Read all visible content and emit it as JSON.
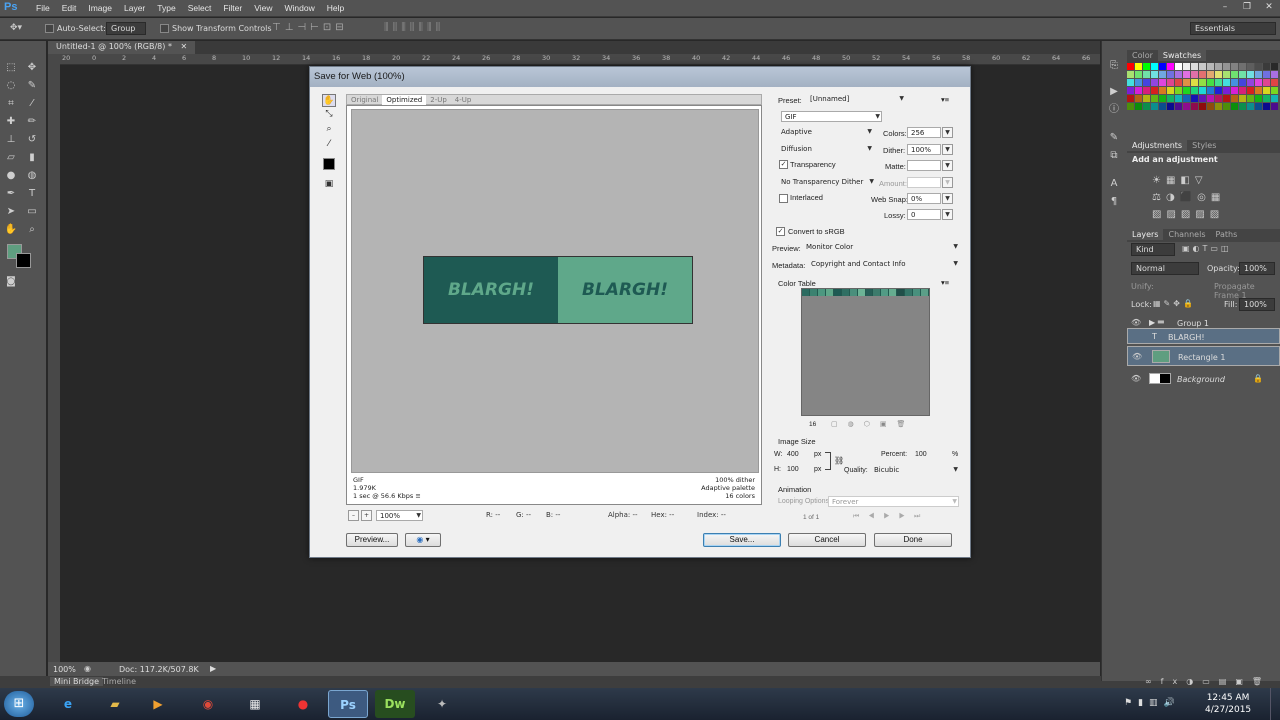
{
  "app": {
    "logo": "Ps",
    "menu": [
      "File",
      "Edit",
      "Image",
      "Layer",
      "Type",
      "Select",
      "Filter",
      "View",
      "Window",
      "Help"
    ],
    "workspace": "Essentials"
  },
  "options_bar": {
    "auto_select_label": "Auto-Select:",
    "auto_select_value": "Group",
    "show_transform_label": "Show Transform Controls"
  },
  "document_tab": "Untitled-1 @ 100% (RGB/8) *",
  "ruler_labels": [
    "20",
    "0",
    "2",
    "4",
    "6",
    "8",
    "10",
    "12",
    "14",
    "16",
    "18",
    "20",
    "22",
    "24",
    "26",
    "28",
    "30",
    "32",
    "34",
    "36",
    "38",
    "40",
    "42",
    "44",
    "46",
    "48",
    "50",
    "52",
    "54",
    "56",
    "58",
    "60",
    "62",
    "64",
    "66"
  ],
  "status": {
    "zoom": "100%",
    "doc": "Doc: 117.2K/507.8K"
  },
  "bottom_tabs": {
    "mini_bridge": "Mini Bridge",
    "timeline": "Timeline"
  },
  "panels": {
    "color_tabs": [
      "Color",
      "Swatches"
    ],
    "adjust_tabs": [
      "Adjustments",
      "Styles"
    ],
    "add_adjustment": "Add an adjustment",
    "layer_tabs": [
      "Layers",
      "Channels",
      "Paths"
    ],
    "kind": "Kind",
    "blend_mode": "Normal",
    "opacity_label": "Opacity:",
    "opacity_value": "100%",
    "unify_label": "Unify:",
    "propagate_label": "Propagate Frame 1",
    "lock_label": "Lock:",
    "fill_label": "Fill:",
    "fill_value": "100%",
    "layers": [
      {
        "name": "Group 1",
        "type": "group"
      },
      {
        "name": "BLARGH!",
        "type": "text"
      },
      {
        "name": "Rectangle 1",
        "type": "shape"
      },
      {
        "name": "Background",
        "type": "background"
      }
    ]
  },
  "dialog": {
    "title": "Save for Web (100%)",
    "view_tabs": [
      "Original",
      "Optimized",
      "2-Up",
      "4-Up"
    ],
    "banner_text_left": "BLARGH!",
    "banner_text_right": "BLARGH!",
    "banner_color_left": "#1e5a53",
    "banner_color_right": "#5fa88a",
    "info_left": [
      "GIF",
      "1.979K",
      "1 sec @ 56.6 Kbps"
    ],
    "info_right": [
      "100% dither",
      "Adaptive palette",
      "16 colors"
    ],
    "zoom": "100%",
    "readouts": {
      "r": "R: --",
      "g": "G: --",
      "b": "B: --",
      "alpha": "Alpha: --",
      "hex": "Hex: --",
      "index": "Index: --"
    },
    "preset_label": "Preset:",
    "preset_value": "[Unnamed]",
    "format": "GIF",
    "reduction": "Adaptive",
    "colors_label": "Colors:",
    "colors_value": "256",
    "dither_algo": "Diffusion",
    "dither_label": "Dither:",
    "dither_value": "100%",
    "transparency_label": "Transparency",
    "matte_label": "Matte:",
    "transparency_dither": "No Transparency Dither",
    "amount_label": "Amount:",
    "interlaced_label": "Interlaced",
    "websnap_label": "Web Snap:",
    "websnap_value": "0%",
    "lossy_label": "Lossy:",
    "lossy_value": "0",
    "convert_label": "Convert to sRGB",
    "preview_label": "Preview:",
    "preview_value": "Monitor Color",
    "metadata_label": "Metadata:",
    "metadata_value": "Copyright and Contact Info",
    "color_table_label": "Color Table",
    "color_count": "16",
    "image_size_label": "Image Size",
    "w_label": "W:",
    "w_value": "400",
    "h_label": "H:",
    "h_value": "100",
    "px": "px",
    "percent_label": "Percent:",
    "percent_value": "100",
    "percent_sign": "%",
    "quality_label": "Quality:",
    "quality_value": "Bicubic",
    "animation_label": "Animation",
    "looping_label": "Looping Options:",
    "looping_value": "Forever",
    "frame_counter": "1 of 1",
    "preview_btn": "Preview...",
    "save_btn": "Save...",
    "cancel_btn": "Cancel",
    "done_btn": "Done"
  },
  "taskbar": {
    "time": "12:45 AM",
    "date": "4/27/2015"
  }
}
